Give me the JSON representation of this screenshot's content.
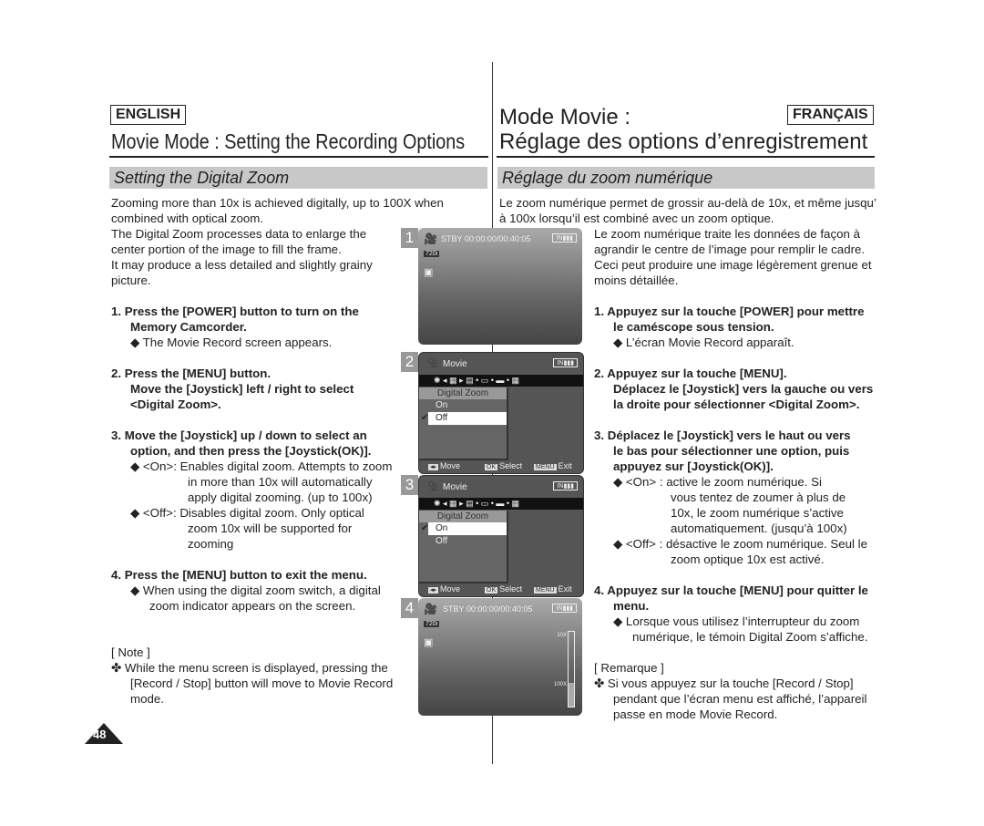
{
  "header": {
    "lang_en": "ENGLISH",
    "lang_fr": "FRANÇAIS",
    "title_en": "Movie Mode : Setting the Recording Options",
    "title_fr_1": "Mode Movie :",
    "title_fr_2": "Réglage des options d’enregistrement"
  },
  "sections": {
    "en": "Setting the Digital Zoom",
    "fr": "Réglage du zoom numérique"
  },
  "en": {
    "intro": [
      "Zooming more than 10x is achieved digitally, up to 100X when",
      "combined with optical zoom.",
      "The Digital Zoom processes data to enlarge the",
      "center portion of the image to fill the frame.",
      "It may produce a less detailed and slightly grainy",
      "picture."
    ],
    "step1": [
      "1.  Press the [POWER] button to turn on the",
      "Memory Camcorder."
    ],
    "step1_b": "◆  The Movie Record screen appears.",
    "step2": [
      "2.  Press the [MENU] button.",
      "Move the [Joystick] left / right to select",
      "<Digital Zoom>."
    ],
    "step3": [
      "3.  Move the [Joystick] up / down to select an",
      "option, and then press the [Joystick(OK)]."
    ],
    "step3_on": [
      "◆  <On>: Enables digital zoom. Attempts to zoom",
      "in more than 10x will automatically",
      "apply digital zooming. (up to 100x)"
    ],
    "step3_off": [
      "◆  <Off>: Disables digital zoom. Only optical",
      "zoom 10x will be supported for",
      "zooming"
    ],
    "step4": "4.  Press the [MENU] button to exit the menu.",
    "step4_b": [
      "◆  When using the digital zoom switch, a digital",
      "zoom indicator appears on the screen."
    ],
    "note_title": "[ Note ]",
    "note": [
      "✤  While the menu screen is displayed, pressing the",
      "[Record / Stop] button will move to Movie Record",
      "mode."
    ]
  },
  "fr": {
    "intro1": [
      "Le zoom numérique permet de grossir au-delà de 10x, et même jusqu’",
      "à 100x lorsqu’il est combiné avec un zoom optique."
    ],
    "intro2": [
      "Le zoom numérique traite les données de façon à",
      "agrandir le centre de l’image pour remplir le cadre.",
      "Ceci peut produire une image légèrement grenue et",
      "moins détaillée."
    ],
    "step1": [
      "1.  Appuyez sur la touche [POWER] pour mettre",
      "le caméscope sous tension."
    ],
    "step1_b": "◆  L’écran Movie Record apparaît.",
    "step2": [
      "2.  Appuyez sur la touche [MENU].",
      "Déplacez le [Joystick] vers la gauche ou vers",
      "la droite pour sélectionner <Digital Zoom>."
    ],
    "step3": [
      "3.  Déplacez le [Joystick] vers le haut ou vers",
      "le bas pour sélectionner une option, puis",
      "appuyez sur [Joystick(OK)]."
    ],
    "step3_on": [
      "◆  <On> :  active le zoom numérique. Si",
      "vous tentez de zoumer à plus de",
      "10x, le zoom numérique s’active",
      "automatiquement. (jusqu’à 100x)"
    ],
    "step3_off": [
      "◆  <Off> : désactive le zoom numérique. Seul le",
      "zoom optique 10x est activé."
    ],
    "step4": [
      "4.  Appuyez sur la touche [MENU] pour quitter le",
      "menu."
    ],
    "step4_b": [
      "◆  Lorsque vous utilisez l’interrupteur du zoom",
      "numérique, le témoin Digital Zoom s’affiche."
    ],
    "note_title": "[ Remarque ]",
    "note": [
      "✤  Si vous appuyez sur la touche [Record / Stop]",
      "pendant que l’écran menu est affiché, l’appareil",
      "passe en mode Movie Record."
    ]
  },
  "screens": {
    "s1": {
      "num": "1",
      "status": "STBY 00:00:00/00:40:05",
      "res": "720i"
    },
    "s2": {
      "num": "2",
      "mode": "Movie",
      "menu_title": "Digital Zoom",
      "options": [
        "On",
        "Off"
      ],
      "selected": "Off",
      "foot_move": "Move",
      "foot_ok": "OK",
      "foot_select": "Select",
      "foot_menu": "MENU",
      "foot_exit": "Exit"
    },
    "s3": {
      "num": "3",
      "mode": "Movie",
      "menu_title": "Digital Zoom",
      "options": [
        "On",
        "Off"
      ],
      "selected": "On",
      "foot_move": "Move",
      "foot_ok": "OK",
      "foot_select": "Select",
      "foot_menu": "MENU",
      "foot_exit": "Exit"
    },
    "s4": {
      "num": "4",
      "status": "STBY 00:00:00/00:40:05",
      "res": "720i",
      "zoom_top": "10X",
      "zoom_bottom": "100X"
    }
  },
  "page_number": "48"
}
